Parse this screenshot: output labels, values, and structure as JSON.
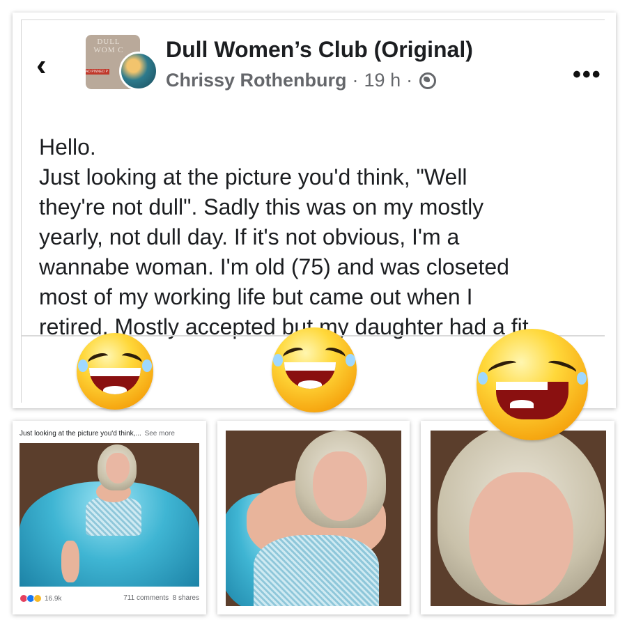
{
  "header": {
    "back_icon": "back-chevron-icon",
    "group_name": "Dull Women’s Club (Original)",
    "author": "Chrissy Rothenburg",
    "separator": "·",
    "time": "19 h",
    "privacy_icon": "globe-icon",
    "more_icon": "more-options-icon",
    "avatar_text": "DULL WOM C",
    "avatar_badge": "AD PINNED P"
  },
  "post": {
    "lines": [
      "Hello.",
      "Just looking at the picture you'd think, \"Well",
      "they're not dull\". Sadly this was on my mostly",
      "yearly, not dull day. If it's not obvious, I'm a",
      "wannabe woman. I'm old (75) and was closeted",
      "most of my working life but came out when I",
      "retired. Mostly accepted but my daughter had a fit."
    ]
  },
  "overlay": {
    "emoji_icon": "laughing-face-emoji"
  },
  "preview": {
    "caption": "Just looking at the picture you'd think,...",
    "see_more": "See more",
    "reaction_count": "16.9k",
    "comments": "711 comments",
    "shares": "8 shares"
  },
  "colors": {
    "text": "#1c1e21",
    "secondary": "#65676b",
    "dress": "#3fb5d3",
    "emoji": "#ffd83a"
  }
}
